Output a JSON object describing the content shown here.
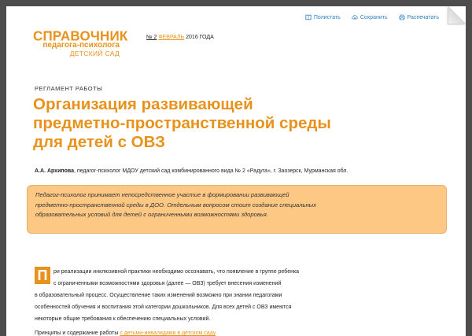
{
  "toolbar": {
    "items": [
      {
        "label": "Полистать",
        "icon": "book-icon"
      },
      {
        "label": "Сохранить",
        "icon": "cloud-download-icon"
      },
      {
        "label": "Распечатать",
        "icon": "printer-icon"
      }
    ]
  },
  "logo": {
    "line1": "СПРАВОЧНИК",
    "line2": "педагога-психолога",
    "line3": "ДЕТСКИЙ САД"
  },
  "issue": {
    "number": "№ 2",
    "month": "ФЕВРАЛЬ",
    "year": "2016 ГОДА"
  },
  "article": {
    "rubric": "РЕГЛАМЕНТ РАБОТЫ",
    "title_lines": [
      "Организация развивающей",
      "предметно-пространственной среды",
      "для детей с ОВЗ"
    ],
    "author_name": "А.А. Архипова",
    "author_info": ", педагог-психолог МДОУ детский сад комбинированного вида № 2 «Радуга», г. Заозерск, Мурманская обл.",
    "lead_lines": [
      "Педагог-психолог принимает непосредственное участие в формировании развивающей",
      "предметно-пространственной среды в ДОО. Отдельным вопросом стоит создание специальных",
      "образовательных условий для детей с ограниченными возможностями здоровья."
    ],
    "dropcap": "П",
    "body_lines": [
      "ри реализации инклюзивной практики необходимо осознавать, что появление в группе ребенка",
      "с ограниченными возможностями здоровья (далее — ОВЗ) требует внесения изменений",
      "в образовательный процесс. Осуществление таких изменений возможно при знании педагогами",
      "особенностей обучения и воспитания этой категории дошкольников. Для всех детей с ОВЗ имеются",
      "некоторые общие требования к обеспечению специальных условий."
    ],
    "next_para_start": "Принципы и содержание работы",
    "next_para_link": "с детьми-инвалидами в детском саду"
  },
  "colors": {
    "accent": "#e8921c",
    "lead_bg": "#fdc784",
    "link": "#2e7fc0",
    "frame": "#4d4d4d"
  }
}
